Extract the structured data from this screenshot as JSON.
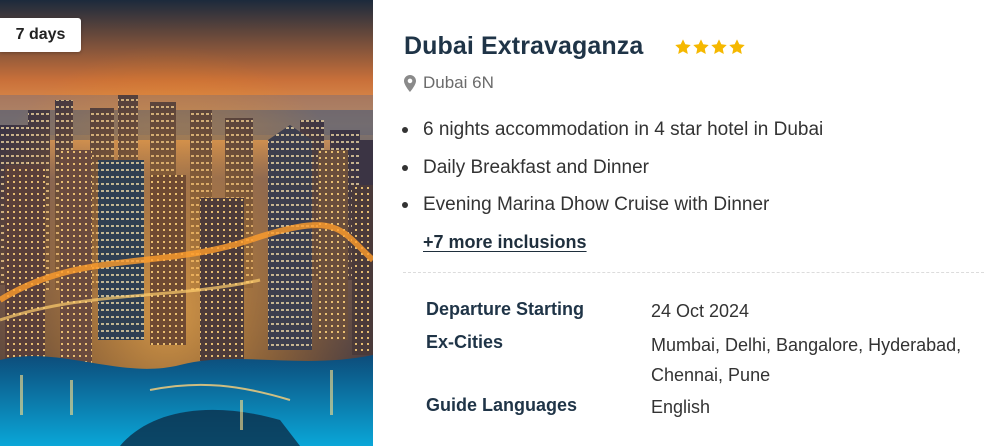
{
  "package": {
    "duration_badge": "7 days",
    "title": "Dubai Extravaganza",
    "star_rating": 4,
    "location": "Dubai 6N",
    "inclusions": [
      "6 nights accommodation in 4 star hotel in Dubai",
      "Daily Breakfast and Dinner",
      "Evening Marina Dhow Cruise with Dinner"
    ],
    "more_inclusions_link": "+7 more inclusions"
  },
  "details": {
    "departure": {
      "label": "Departure Starting",
      "value": "24 Oct 2024"
    },
    "ex_cities": {
      "label": "Ex-Cities",
      "value": "Mumbai, Delhi, Bangalore, Hyderabad, Chennai, Pune"
    },
    "guide_languages": {
      "label": "Guide Languages",
      "value": "English"
    }
  },
  "colors": {
    "star": "#f5b800",
    "title": "#1f3447",
    "body_text": "#333333",
    "muted_text": "#6b6b6b"
  },
  "icons": {
    "star": "star-icon",
    "location": "map-pin-icon"
  }
}
